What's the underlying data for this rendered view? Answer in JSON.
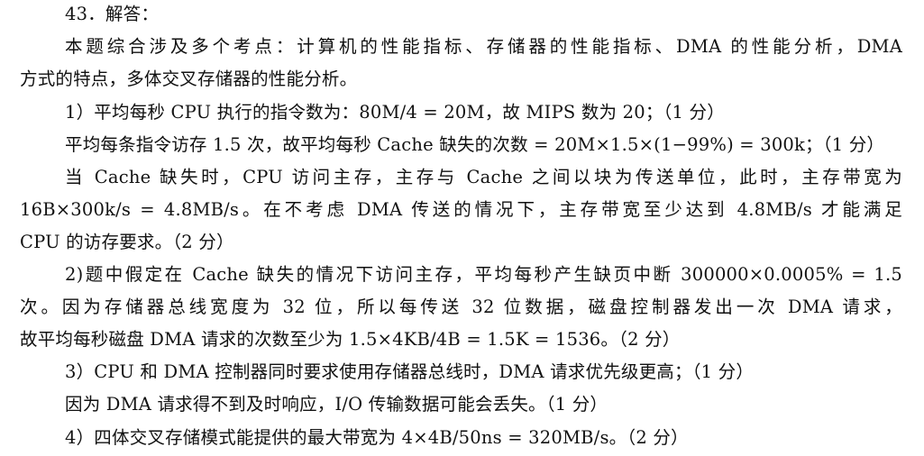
{
  "heading": "43．解答：",
  "lines": [
    "本题综合涉及多个考点：计算机的性能指标、存储器的性能指标、DMA 的性能分析，DMA",
    "方式的特点，多体交叉存储器的性能分析。",
    "1）平均每秒 CPU 执行的指令数为：80M/4 = 20M，故 MIPS 数为 20；（1 分）",
    "平均每条指令访存 1.5 次，故平均每秒 Cache 缺失的次数 = 20M×1.5×(1−99%) = 300k；（1 分）",
    "当 Cache 缺失时，CPU 访问主存，主存与 Cache 之间以块为传送单位，此时，主存带宽为",
    "16B×300k/s = 4.8MB/s。在不考虑 DMA 传送的情况下，主存带宽至少达到 4.8MB/s 才能满足",
    "CPU 的访存要求。（2 分）",
    "2)题中假定在 Cache 缺失的情况下访问主存，平均每秒产生缺页中断 300000×0.0005% = 1.5",
    "次。因为存储器总线宽度为 32 位，所以每传送 32 位数据，磁盘控制器发出一次 DMA 请求，",
    "故平均每秒磁盘 DMA 请求的次数至少为 1.5×4KB/4B = 1.5K = 1536。（2 分）",
    "3）CPU 和 DMA 控制器同时要求使用存储器总线时，DMA 请求优先级更高；（1 分）",
    "因为 DMA 请求得不到及时响应，I/O 传输数据可能会丢失。（1 分）",
    "4）四体交叉存储模式能提供的最大带宽为 4×4B/50ns = 320MB/s。（2 分）"
  ]
}
